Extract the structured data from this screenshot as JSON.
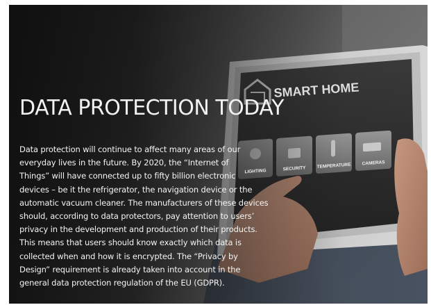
{
  "banner": {
    "heading": "DATA PROTECTION TODAY",
    "paragraph_lines": [
      "Data protection will continue to affect many areas of our",
      "everyday lives in the future. By 2020, the “Internet of",
      "Things” will have connected up to fifty billion electronic",
      "devices – be it the refrigerator, the navigation device or the",
      "automatic vacuum cleaner. The manufacturers of these devices",
      "should, according to data protectors, pay attention to users’",
      "privacy in the development and production of their products.",
      "This means that users should know exactly which data is",
      "collected when and how it is encrypted. The “Privacy by",
      "Design” requirement is already taken into account in the",
      "general data protection regulation of the EU (GDPR)."
    ]
  },
  "tablet_screen": {
    "title": "SMART HOME",
    "tiles": [
      "LIGHTING",
      "SECURITY",
      "TEMPERATURE",
      "CAMERAS"
    ],
    "tile_icons": [
      "bulb-icon",
      "lock-icon",
      "thermometer-icon",
      "camera-icon"
    ],
    "home_icon": "house-icon"
  },
  "colors": {
    "text": "#f4f4f4",
    "overlay_dark": "#0c0c0c",
    "tablet_screen": "#2c2c2c"
  }
}
